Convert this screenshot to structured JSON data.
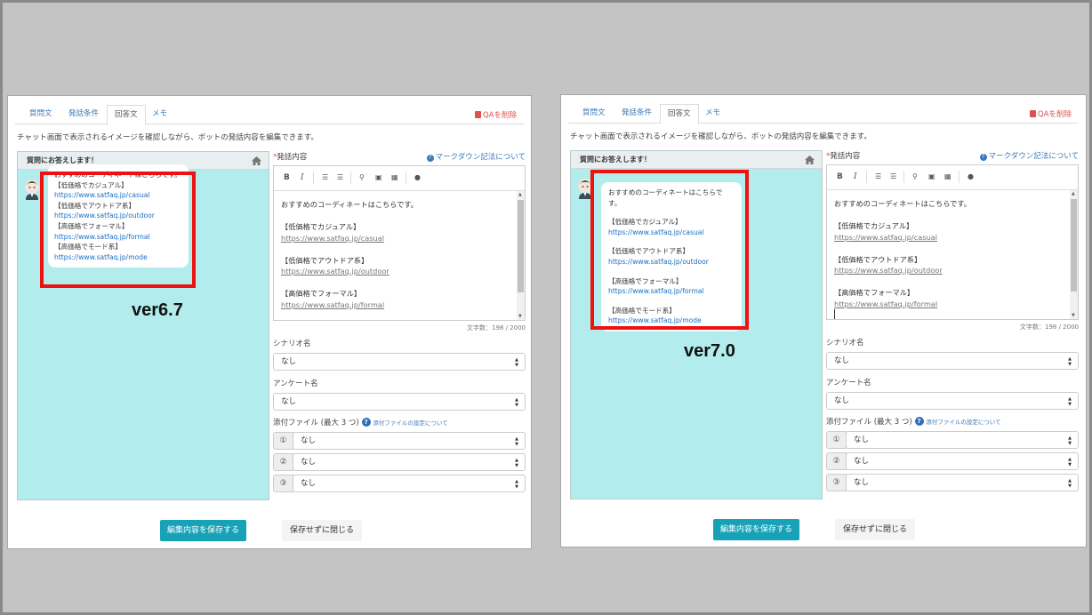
{
  "tabs": [
    "質問文",
    "発話条件",
    "回答文",
    "メモ"
  ],
  "delete_qa": "QAを削除",
  "description": "チャット画面で表示されるイメージを確認しながら、ボットの発話内容を編集できます。",
  "chat_header": "質問にお答えします！",
  "bubble_lines": {
    "intro": "おすすめのコーディネートはこちらです。",
    "c1": "【低価格でカジュアル】",
    "l1": "https://www.satfaq.jp/casual",
    "c2": "【低価格でアウトドア系】",
    "l2": "https://www.satfaq.jp/outdoor",
    "c3": "【高価格でフォーマル】",
    "l3": "https://www.satfaq.jp/formal",
    "c4": "【高価格でモード系】",
    "l4": "https://www.satfaq.jp/mode"
  },
  "form": {
    "content_label": "発話内容",
    "required_mark": "*",
    "markdown_link": "マークダウン記法について",
    "char_count": "文字数：198 / 2000",
    "scenario_label": "シナリオ名",
    "survey_label": "アンケート名",
    "attach_label": "添付ファイル (最大 3 つ)",
    "attach_link": "添付ファイルの設定について",
    "none": "なし",
    "nums": [
      "①",
      "②",
      "③"
    ]
  },
  "buttons": {
    "save": "編集内容を保存する",
    "close": "保存せずに閉じる"
  },
  "versions": {
    "left": "ver6.7",
    "right": "ver7.0"
  },
  "colors": {
    "highlight": "#ee1111",
    "chat_bg": "#b2ecec",
    "save_btn": "#17a2b8",
    "link": "#1a6fc4"
  }
}
